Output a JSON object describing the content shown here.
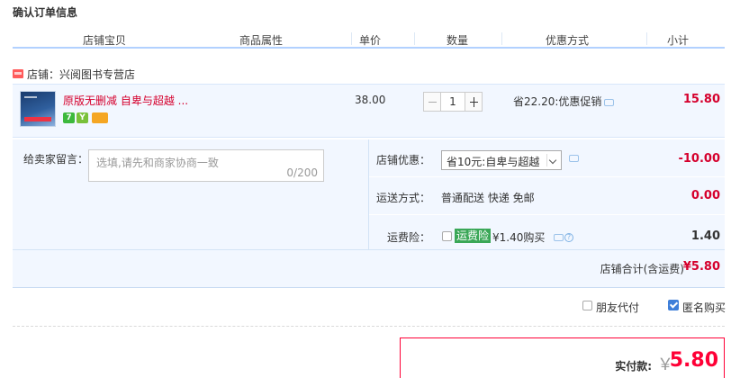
{
  "section_title": "确认订单信息",
  "columns": [
    "店铺宝贝",
    "商品属性",
    "单价",
    "数量",
    "优惠方式",
    "小计"
  ],
  "shop": {
    "label": "店铺：兴阅图书专营店"
  },
  "item": {
    "title": "原版无删减 自卑与超越 ...",
    "badges": [
      "7",
      "Y",
      ""
    ],
    "unit_price": "38.00",
    "quantity": "1",
    "promotion": "省22.20:优惠促销",
    "subtotal": "15.80"
  },
  "message": {
    "label": "给卖家留言：",
    "placeholder": "选填,请先和商家协商一致",
    "counter": "0/200"
  },
  "shop_discount": {
    "label": "店铺优惠：",
    "selected": "省10元:自卑与超越",
    "amount": "-10.00"
  },
  "shipping": {
    "label": "运送方式：",
    "method": "普通配送 快递 免邮",
    "amount": "0.00"
  },
  "insurance": {
    "label": "运费险：",
    "tag": "运费险",
    "price_text": "¥1.40购买",
    "amount": "1.40"
  },
  "shop_total": {
    "label": "店铺合计(含运费)",
    "value": "¥5.80"
  },
  "footer_options": {
    "friend_pay": "朋友代付",
    "friend_pay_checked": false,
    "anonymous": "匿名购买",
    "anonymous_checked": true
  },
  "payment": {
    "label": "实付款:",
    "currency": "￥",
    "amount": "5.80"
  },
  "colors": {
    "accent_red": "#d5002d",
    "pay_red": "#ff0036",
    "header_border": "#b2d1ff",
    "panel_bg": "#f2f7ff"
  }
}
